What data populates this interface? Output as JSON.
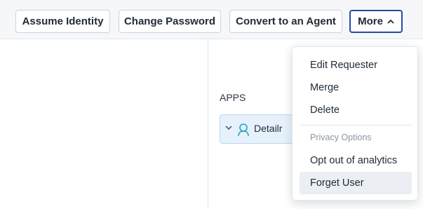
{
  "toolbar": {
    "assume_identity_label": "Assume Identity",
    "change_password_label": "Change Password",
    "convert_agent_label": "Convert to an Agent",
    "more_label": "More"
  },
  "apps": {
    "label": "APPS",
    "items": [
      {
        "name": "Detailr",
        "icon": "user-outline-icon"
      }
    ]
  },
  "more_menu": {
    "items": [
      "Edit Requester",
      "Merge",
      "Delete"
    ],
    "group_label": "Privacy Options",
    "privacy_items": [
      "Opt out of analytics",
      "Forget User"
    ],
    "highlighted": "Forget User"
  },
  "colors": {
    "accent": "#264c9e",
    "app_card_bg": "#e7f1fb",
    "app_icon": "#1fa3c7"
  }
}
